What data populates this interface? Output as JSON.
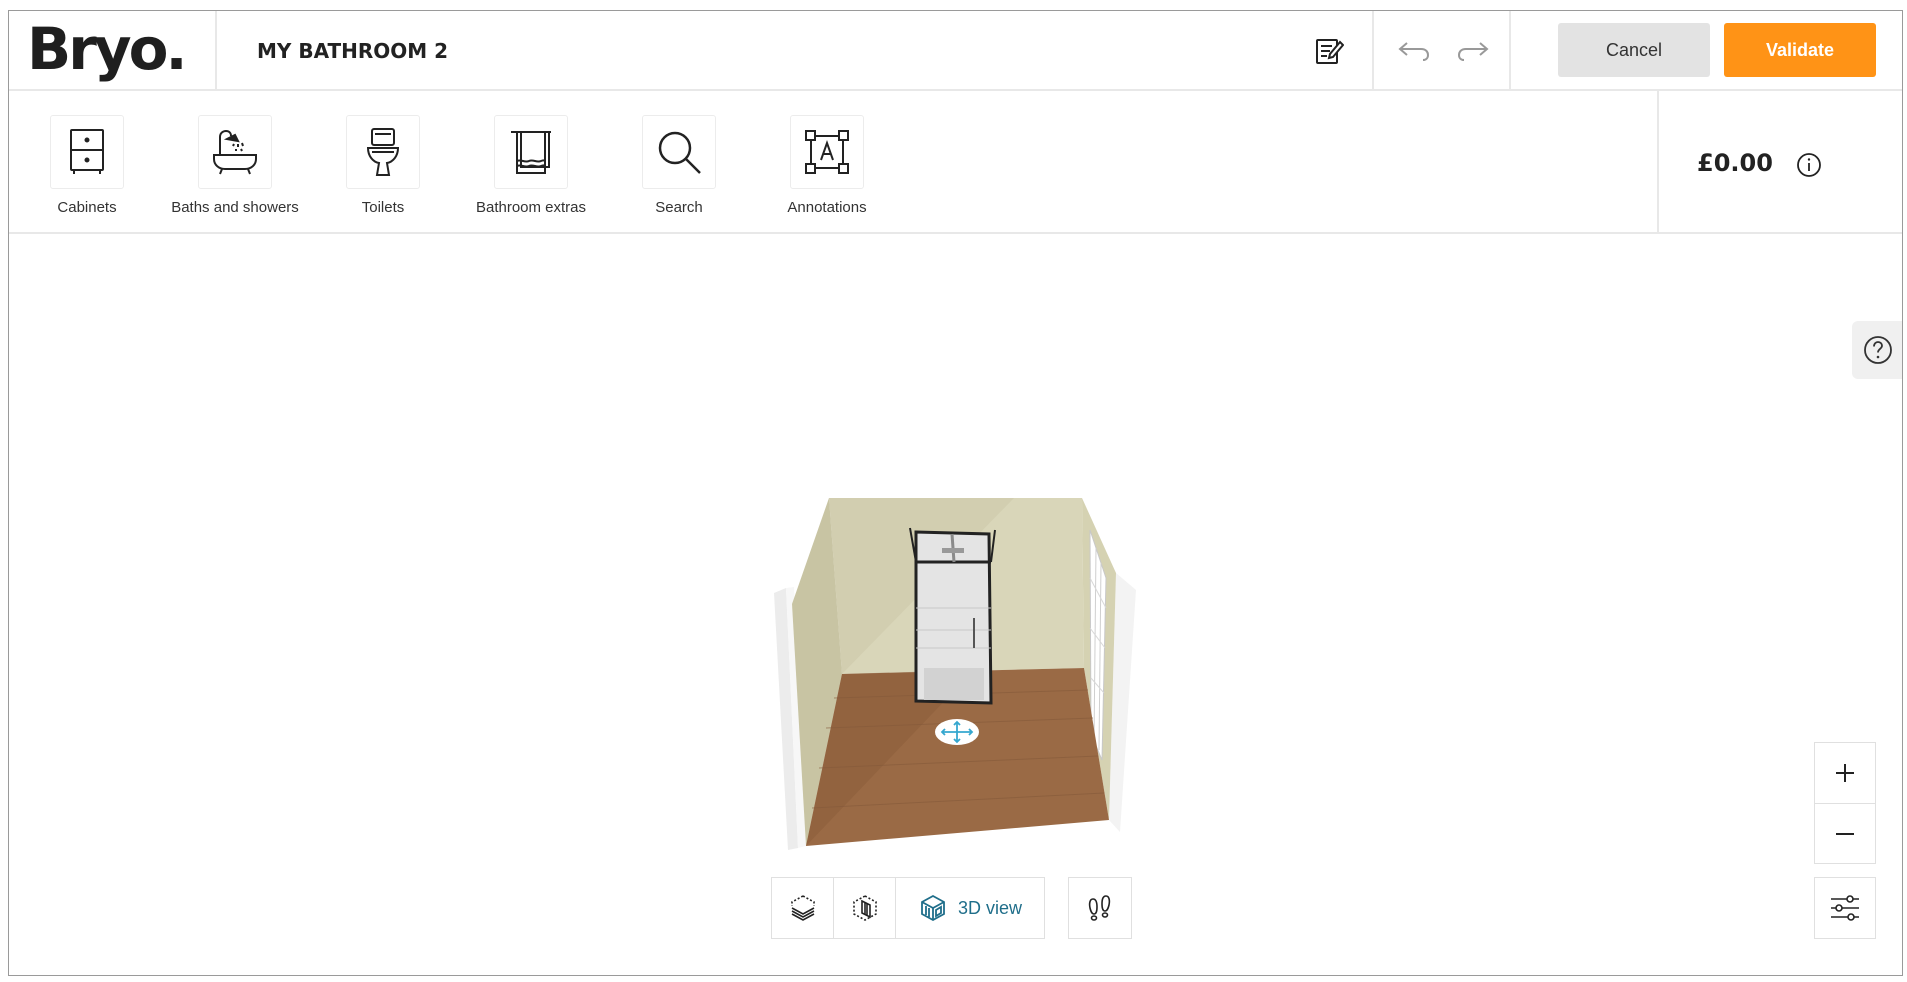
{
  "app": {
    "logo": "Bryo."
  },
  "header": {
    "project_title": "MY BATHROOM 2",
    "cancel_label": "Cancel",
    "validate_label": "Validate",
    "edit_icon": "edit-notes-icon",
    "undo_icon": "undo-arrow-icon",
    "redo_icon": "redo-arrow-icon"
  },
  "toolbar": {
    "tools": [
      {
        "label": "Cabinets",
        "icon": "cabinet-icon"
      },
      {
        "label": "Baths and showers",
        "icon": "bath-shower-icon"
      },
      {
        "label": "Toilets",
        "icon": "toilet-icon"
      },
      {
        "label": "Bathroom extras",
        "icon": "towel-icon"
      },
      {
        "label": "Search",
        "icon": "search-icon"
      },
      {
        "label": "Annotations",
        "icon": "annotation-icon"
      }
    ],
    "price": "£0.00",
    "price_info_icon": "info-icon"
  },
  "canvas": {
    "help_icon": "help-icon",
    "view_modes": [
      {
        "icon": "floor-plan-2d-icon"
      },
      {
        "icon": "walls-view-icon"
      },
      {
        "icon": "3d-view-icon",
        "label": "3D view",
        "active": true
      }
    ],
    "walk_icon": "footprints-icon",
    "zoom_in_icon": "plus-icon",
    "zoom_out_icon": "minus-icon",
    "settings_icon": "sliders-icon"
  },
  "colors": {
    "accent": "#ff9316",
    "cancel_bg": "#e3e3e3",
    "active_view": "#1f6e8a",
    "wall": "#d9d6b9",
    "floor": "#9a6a45"
  }
}
